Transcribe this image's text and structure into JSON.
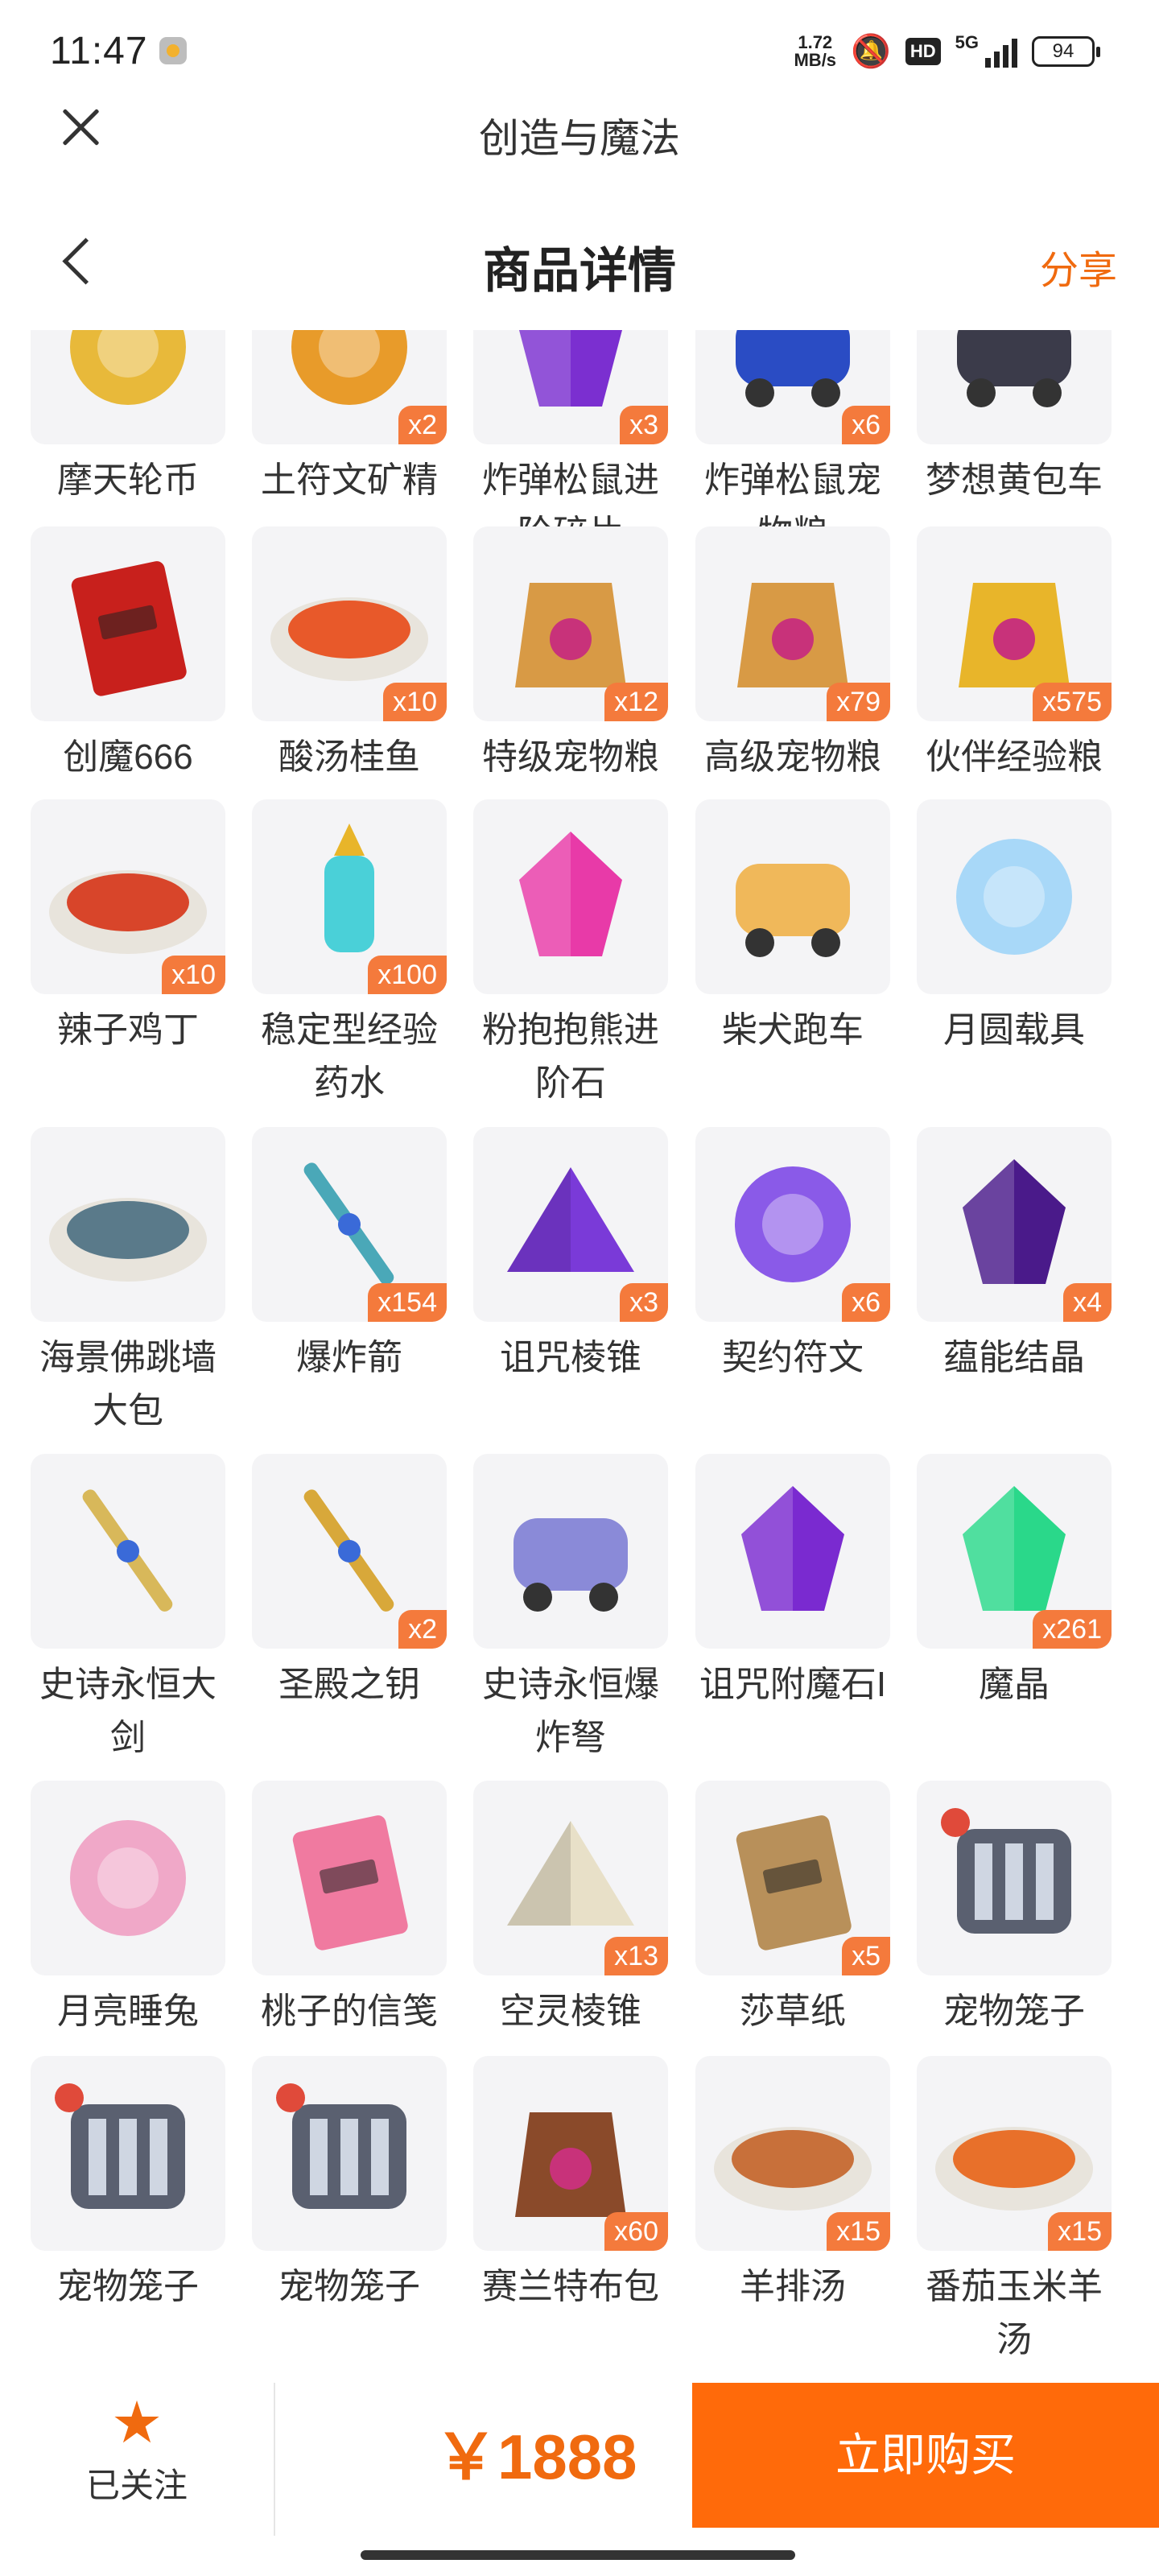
{
  "status": {
    "time": "11:47",
    "net_speed_value": "1.72",
    "net_speed_unit": "MB/s",
    "hd": "HD",
    "network": "5G",
    "battery": "94"
  },
  "appbar": {
    "title": "创造与魔法"
  },
  "header": {
    "title": "商品详情",
    "share": "分享"
  },
  "items": [
    {
      "name": "摩天轮币",
      "qty": "",
      "icon": "ferris-coin-icon",
      "color": "#e8b93a"
    },
    {
      "name": "土符文矿精",
      "qty": "x2",
      "icon": "earth-rune-ore-icon",
      "color": "#e89b2a"
    },
    {
      "name": "炸弹松鼠进阶碎片",
      "qty": "x3",
      "icon": "bomb-squirrel-shard-icon",
      "color": "#7b2fd0"
    },
    {
      "name": "炸弹松鼠宠物粮",
      "qty": "x6",
      "icon": "bomb-squirrel-food-icon",
      "color": "#2a4cc4"
    },
    {
      "name": "梦想黄包车",
      "qty": "",
      "icon": "rickshaw-icon",
      "color": "#3b3b4a"
    },
    {
      "name": "创魔666",
      "qty": "",
      "icon": "card-666-icon",
      "color": "#c8201c"
    },
    {
      "name": "酸汤桂鱼",
      "qty": "x10",
      "icon": "fish-soup-icon",
      "color": "#e8592a"
    },
    {
      "name": "特级宠物粮",
      "qty": "x12",
      "icon": "premium-pet-food-icon",
      "color": "#d89a45"
    },
    {
      "name": "高级宠物粮",
      "qty": "x79",
      "icon": "advanced-pet-food-icon",
      "color": "#d89a45"
    },
    {
      "name": "伙伴经验粮",
      "qty": "x575",
      "icon": "partner-exp-bag-icon",
      "color": "#e8b52a"
    },
    {
      "name": "辣子鸡丁",
      "qty": "x10",
      "icon": "spicy-chicken-icon",
      "color": "#d8452a"
    },
    {
      "name": "稳定型经验药水",
      "qty": "x100",
      "icon": "exp-potion-icon",
      "color": "#4ad0d8"
    },
    {
      "name": "粉抱抱熊进阶石",
      "qty": "",
      "icon": "pink-bear-stone-icon",
      "color": "#e83aa8"
    },
    {
      "name": "柴犬跑车",
      "qty": "",
      "icon": "shiba-car-icon",
      "color": "#f0b85a"
    },
    {
      "name": "月圆载具",
      "qty": "",
      "icon": "moon-vehicle-icon",
      "color": "#a8d8f8"
    },
    {
      "name": "海景佛跳墙大包",
      "qty": "",
      "icon": "buns-plate-icon",
      "color": "#5a7a8a"
    },
    {
      "name": "爆炸箭",
      "qty": "x154",
      "icon": "explosive-arrow-icon",
      "color": "#4aa8b8"
    },
    {
      "name": "诅咒棱锥",
      "qty": "x3",
      "icon": "curse-pyramid-icon",
      "color": "#7a3ad8"
    },
    {
      "name": "契约符文",
      "qty": "x6",
      "icon": "contract-rune-icon",
      "color": "#8a5ae8"
    },
    {
      "name": "蕴能结晶",
      "qty": "x4",
      "icon": "energy-crystal-icon",
      "color": "#4a1a8a"
    },
    {
      "name": "史诗永恒大剑",
      "qty": "",
      "icon": "epic-sword-icon",
      "color": "#d8b85a"
    },
    {
      "name": "圣殿之钥",
      "qty": "x2",
      "icon": "temple-key-icon",
      "color": "#d8a83a"
    },
    {
      "name": "史诗永恒爆炸弩",
      "qty": "",
      "icon": "epic-crossbow-icon",
      "color": "#8a8ad8"
    },
    {
      "name": "诅咒附魔石I",
      "qty": "",
      "icon": "curse-enchant-stone-icon",
      "color": "#7a2ad0"
    },
    {
      "name": "魔晶",
      "qty": "x261",
      "icon": "magic-crystal-icon",
      "color": "#2ad88a"
    },
    {
      "name": "月亮睡兔",
      "qty": "",
      "icon": "moon-rabbit-icon",
      "color": "#f0a8c8"
    },
    {
      "name": "桃子的信笺",
      "qty": "",
      "icon": "peach-letter-icon",
      "color": "#f07aa0"
    },
    {
      "name": "空灵棱锥",
      "qty": "x13",
      "icon": "ethereal-pyramid-icon",
      "color": "#e8e0c8"
    },
    {
      "name": "莎草纸",
      "qty": "x5",
      "icon": "papyrus-icon",
      "color": "#b8905a"
    },
    {
      "name": "宠物笼子",
      "qty": "",
      "icon": "pet-cage-icon",
      "color": "#5a6070"
    },
    {
      "name": "宠物笼子",
      "qty": "",
      "icon": "pet-cage-icon",
      "color": "#5a6070"
    },
    {
      "name": "宠物笼子",
      "qty": "",
      "icon": "pet-cage-icon",
      "color": "#5a6070"
    },
    {
      "name": "赛兰特布包",
      "qty": "x60",
      "icon": "cloth-bag-icon",
      "color": "#8a4a2a"
    },
    {
      "name": "羊排汤",
      "qty": "x15",
      "icon": "lamb-soup-icon",
      "color": "#c8703a"
    },
    {
      "name": "番茄玉米羊汤",
      "qty": "x15",
      "icon": "tomato-corn-soup-icon",
      "color": "#e8702a"
    }
  ],
  "bottom": {
    "follow_label": "已关注",
    "price": "￥1888",
    "buy_label": "立即购买"
  },
  "colors": {
    "accent": "#f06a0f",
    "buy_button": "#ff6a0a",
    "qty_badge": "#f47a3c"
  }
}
